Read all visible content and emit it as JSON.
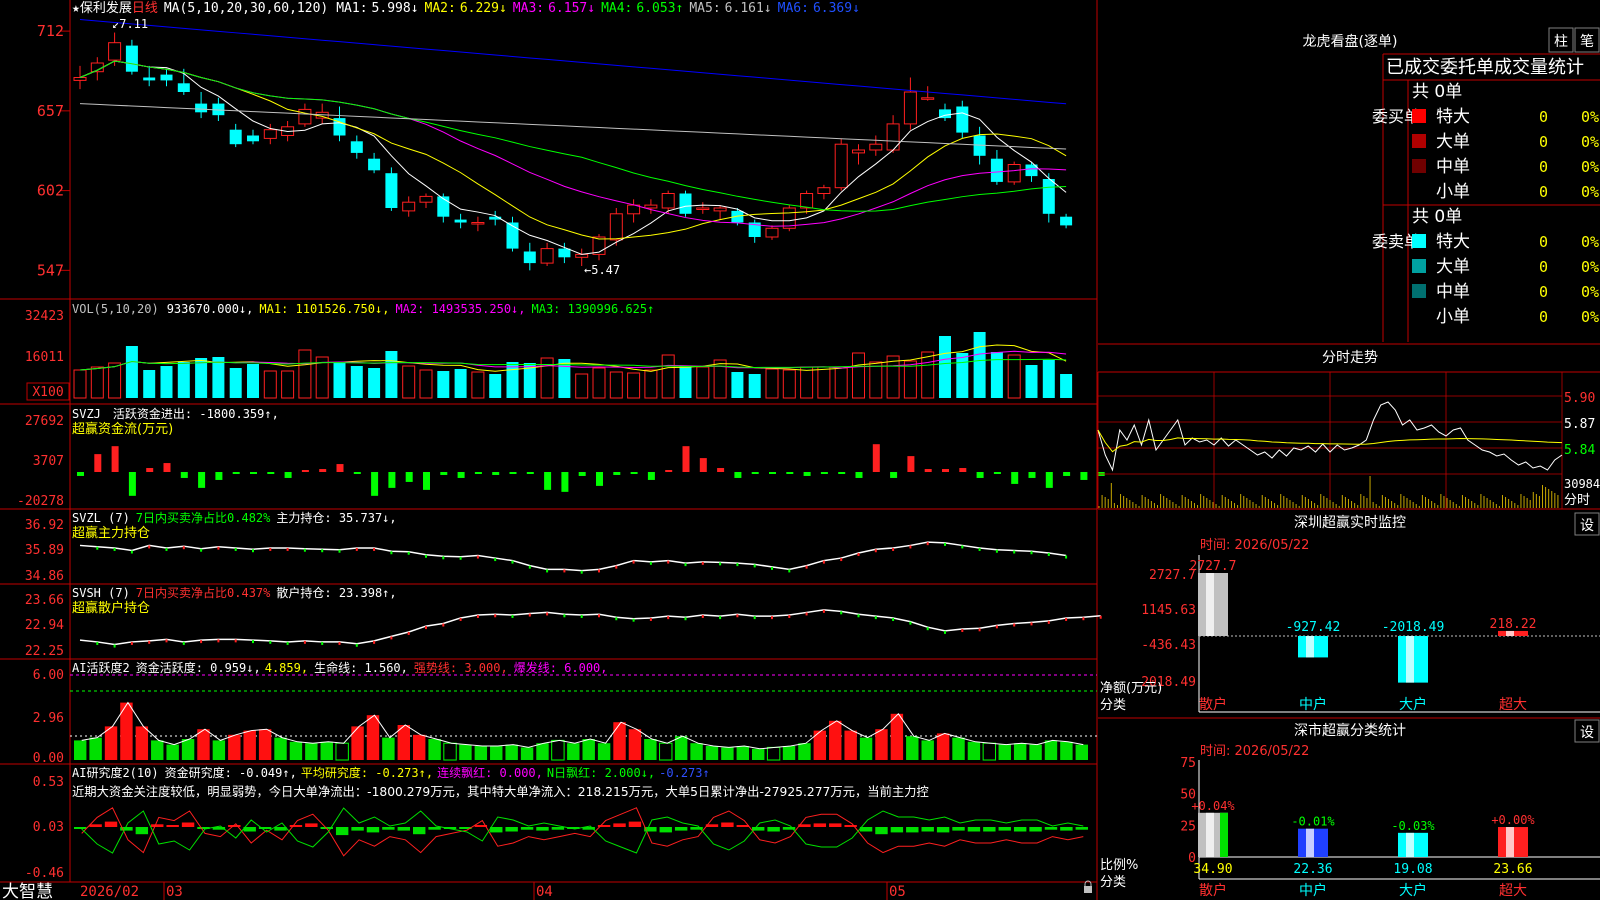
{
  "colors": {
    "up": "#ff2020",
    "down": "#00ffff",
    "bg": "#000000",
    "frame": "#c00000",
    "ma1": "#ffffff",
    "ma2": "#ffff00",
    "ma3": "#ff00ff",
    "ma4": "#00ff00",
    "ma5": "#c0c0c0",
    "ma6": "#0000ff",
    "green": "#00ff00",
    "yellow": "#ffff00",
    "magenta": "#ff00ff",
    "cyan": "#00ffff"
  },
  "app": {
    "name": "大智慧"
  },
  "k_panel": {
    "star": "★",
    "stock": "保利发展",
    "period": "日线",
    "ma_label": "MA(5,10,20,30,60,120)",
    "ma": [
      {
        "name": "MA1:",
        "value": "5.998↓"
      },
      {
        "name": "MA2:",
        "value": "6.229↓"
      },
      {
        "name": "MA3:",
        "value": "6.157↓"
      },
      {
        "name": "MA4:",
        "value": "6.053↑"
      },
      {
        "name": "MA5:",
        "value": "6.161↓"
      },
      {
        "name": "MA6:",
        "value": "6.369↓"
      }
    ],
    "axis": [
      "712",
      "657",
      "602",
      "547"
    ],
    "high_mark": "7.11",
    "low_mark": "5.47"
  },
  "vol_panel": {
    "label": "VOL(5,10,20)",
    "value": "933670.000↓,",
    "ma1": "MA1: 1101526.750↓,",
    "ma2": "MA2: 1493535.250↓,",
    "ma3": "MA3: 1390996.625↑",
    "axis": [
      "32423",
      "16011"
    ],
    "unit": "X100"
  },
  "svzj_panel": {
    "label": "SVZJ",
    "text": "活跃资金进出: -1800.359↑,",
    "title": "超赢资金流(万元)",
    "axis": [
      "27692",
      "3707",
      "-20278"
    ]
  },
  "svzl_panel": {
    "label": "SVZL (7)",
    "pct": "7日内买卖净占比0.482%",
    "main": "主力持仓: 35.737↓,",
    "title": "超赢主力持仓",
    "axis": [
      "36.92",
      "35.89",
      "34.86"
    ]
  },
  "svsh_panel": {
    "label": "SVSH (7)",
    "pct": "7日内买卖净占比0.437%",
    "retail": "散户持仓: 23.398↑,",
    "title": "超赢散户持仓",
    "axis": [
      "23.66",
      "22.94",
      "22.25"
    ]
  },
  "ai1_panel": {
    "label": "AI活跃度2",
    "t1": "资金活跃度: 0.959↓,",
    "t2": "4.859,",
    "t3": "生命线: 1.560,",
    "t4": "强势线: 3.000,",
    "t5": "爆发线: 6.000,",
    "axis": [
      "6.00",
      "2.96",
      "0.00"
    ]
  },
  "ai2_panel": {
    "label": "AI研究度2(10)",
    "t1": "资金研究度: -0.049↑,",
    "t2": "平均研究度: -0.273↑,",
    "t3": "连续飘红: 0.000,",
    "t4": "N日飘红: 2.000↓,",
    "t5": "-0.273↑",
    "comment": "近期大资金关注度较低，明显弱势，今日大单净流出：-1800.279万元，其中特大单净流入：218.215万元，大单5日累计净出-27925.277万元，当前主力控",
    "axis": [
      "0.53",
      "0.03",
      "-0.46"
    ]
  },
  "dates": {
    "d1": "2026/02",
    "d2": "03",
    "d3": "04",
    "d4": "05"
  },
  "dragon": {
    "title": "龙虎看盘(逐单)",
    "btn1": "柱",
    "btn2": "笔",
    "subtitle": "已成交委托单成交量统计",
    "buy": {
      "side": "委买单",
      "total": "共 0单",
      "rows": [
        {
          "name": "特大",
          "n": "0",
          "p": "0%",
          "c": "#ff0000"
        },
        {
          "name": "大单",
          "n": "0",
          "p": "0%",
          "c": "#b00000"
        },
        {
          "name": "中单",
          "n": "0",
          "p": "0%",
          "c": "#700000"
        },
        {
          "name": "小单",
          "n": "0",
          "p": "0%",
          "c": "#000000"
        }
      ]
    },
    "sell": {
      "side": "委卖单",
      "total": "共 0单",
      "rows": [
        {
          "name": "特大",
          "n": "0",
          "p": "0%",
          "c": "#00ffff"
        },
        {
          "name": "大单",
          "n": "0",
          "p": "0%",
          "c": "#00a0a0"
        },
        {
          "name": "中单",
          "n": "0",
          "p": "0%",
          "c": "#007070"
        },
        {
          "name": "小单",
          "n": "0",
          "p": "0%",
          "c": "#000000"
        }
      ]
    }
  },
  "fenshi": {
    "title": "分时走势",
    "axis": [
      "5.90",
      "5.87",
      "5.84"
    ],
    "vol": "30984",
    "vol_unit": "分时"
  },
  "monitor": {
    "title": "深圳超赢实时监控",
    "btn": "设",
    "time": "时间: 2026/05/22",
    "axis": [
      "2727.7",
      "1145.63",
      "-436.43",
      "-2018.49"
    ],
    "label1": "净额(万元)",
    "label2": "分类",
    "cats": [
      "散户",
      "中户",
      "大户",
      "超大"
    ],
    "vals": [
      "2727.7",
      "-927.42",
      "-2018.49",
      "218.22"
    ]
  },
  "classify": {
    "title": "深市超赢分类统计",
    "btn": "设",
    "time": "时间: 2026/05/22",
    "axis": [
      "75",
      "50",
      "25",
      "0"
    ],
    "label1": "比例%",
    "label2": "分类",
    "cats": [
      "散户",
      "中户",
      "大户",
      "超大"
    ],
    "vals": [
      "34.90",
      "22.36",
      "19.08",
      "23.66"
    ],
    "chg": [
      "+0.04%",
      "-0.01%",
      "-0.03%",
      "+0.00%"
    ]
  },
  "chart_data": [
    {
      "type": "candlestick",
      "title": "保利发展 日线",
      "ylim": [
        5.3,
        7.3
      ],
      "ohlc": [
        [
          6.78,
          6.88,
          6.72,
          6.8
        ],
        [
          6.84,
          6.94,
          6.78,
          6.9
        ],
        [
          6.92,
          7.11,
          6.88,
          7.04
        ],
        [
          7.02,
          7.06,
          6.82,
          6.84
        ],
        [
          6.8,
          6.88,
          6.74,
          6.78
        ],
        [
          6.82,
          6.86,
          6.74,
          6.78
        ],
        [
          6.76,
          6.86,
          6.68,
          6.7
        ],
        [
          6.62,
          6.7,
          6.52,
          6.56
        ],
        [
          6.62,
          6.66,
          6.5,
          6.54
        ],
        [
          6.44,
          6.48,
          6.32,
          6.34
        ],
        [
          6.4,
          6.44,
          6.34,
          6.36
        ],
        [
          6.38,
          6.48,
          6.34,
          6.44
        ],
        [
          6.4,
          6.5,
          6.36,
          6.46
        ],
        [
          6.48,
          6.62,
          6.46,
          6.58
        ],
        [
          6.52,
          6.62,
          6.48,
          6.56
        ],
        [
          6.52,
          6.6,
          6.36,
          6.4
        ],
        [
          6.36,
          6.4,
          6.24,
          6.28
        ],
        [
          6.24,
          6.28,
          6.14,
          6.16
        ],
        [
          6.14,
          6.18,
          5.88,
          5.9
        ],
        [
          5.88,
          5.98,
          5.84,
          5.94
        ],
        [
          5.94,
          6.0,
          5.9,
          5.98
        ],
        [
          5.98,
          6.0,
          5.8,
          5.84
        ],
        [
          5.82,
          5.86,
          5.76,
          5.8
        ],
        [
          5.8,
          5.84,
          5.74,
          5.8
        ],
        [
          5.84,
          5.88,
          5.78,
          5.82
        ],
        [
          5.8,
          5.84,
          5.6,
          5.62
        ],
        [
          5.6,
          5.66,
          5.47,
          5.52
        ],
        [
          5.52,
          5.66,
          5.5,
          5.62
        ],
        [
          5.62,
          5.66,
          5.52,
          5.56
        ],
        [
          5.56,
          5.62,
          5.5,
          5.58
        ],
        [
          5.58,
          5.72,
          5.54,
          5.7
        ],
        [
          5.68,
          5.9,
          5.64,
          5.86
        ],
        [
          5.86,
          5.96,
          5.8,
          5.92
        ],
        [
          5.9,
          5.96,
          5.86,
          5.92
        ],
        [
          5.9,
          6.02,
          5.86,
          6.0
        ],
        [
          6.0,
          6.02,
          5.84,
          5.86
        ],
        [
          5.9,
          5.94,
          5.86,
          5.9
        ],
        [
          5.88,
          5.92,
          5.82,
          5.9
        ],
        [
          5.88,
          5.9,
          5.78,
          5.8
        ],
        [
          5.8,
          5.82,
          5.66,
          5.7
        ],
        [
          5.7,
          5.78,
          5.68,
          5.76
        ],
        [
          5.76,
          5.92,
          5.74,
          5.9
        ],
        [
          5.9,
          6.02,
          5.86,
          6.0
        ],
        [
          6.0,
          6.06,
          5.96,
          6.04
        ],
        [
          6.04,
          6.38,
          6.02,
          6.34
        ],
        [
          6.28,
          6.34,
          6.2,
          6.3
        ],
        [
          6.3,
          6.4,
          6.26,
          6.34
        ],
        [
          6.3,
          6.54,
          6.28,
          6.48
        ],
        [
          6.48,
          6.8,
          6.44,
          6.7
        ],
        [
          6.66,
          6.74,
          6.64,
          6.66
        ],
        [
          6.58,
          6.62,
          6.5,
          6.52
        ],
        [
          6.6,
          6.64,
          6.38,
          6.42
        ],
        [
          6.4,
          6.46,
          6.2,
          6.26
        ],
        [
          6.24,
          6.3,
          6.06,
          6.08
        ],
        [
          6.08,
          6.22,
          6.06,
          6.2
        ],
        [
          6.2,
          6.22,
          6.08,
          6.12
        ],
        [
          6.1,
          6.14,
          5.8,
          5.86
        ],
        [
          5.84,
          5.86,
          5.76,
          5.78
        ]
      ]
    },
    {
      "type": "bar",
      "title": "VOL(5,10,20)",
      "ylim": [
        0,
        40000
      ],
      "values": [
        14000,
        15500,
        17500,
        26000,
        14000,
        16000,
        18000,
        20000,
        20500,
        15000,
        17000,
        13500,
        13500,
        24000,
        20500,
        18000,
        16000,
        15000,
        23500,
        16000,
        14000,
        13500,
        14500,
        13000,
        12000,
        18000,
        17500,
        20000,
        19500,
        12000,
        15000,
        13000,
        12500,
        14000,
        21500,
        16000,
        15500,
        19000,
        13000,
        12000,
        14500,
        14000,
        15500,
        15500,
        15000,
        22500,
        18000,
        21000,
        18500,
        23000,
        31000,
        22500,
        33000,
        23000,
        21500,
        16500,
        19000,
        12000
      ]
    },
    {
      "type": "bar",
      "title": "超赢资金流(万元)",
      "ylim": [
        -20278,
        27692
      ],
      "values": [
        -2000,
        9000,
        13000,
        -12000,
        2000,
        4500,
        -3000,
        -8000,
        -4000,
        -500,
        -500,
        -500,
        -3000,
        1000,
        1500,
        4000,
        -500,
        -12000,
        -8000,
        -5000,
        -9000,
        -1500,
        -3000,
        -1000,
        -1500,
        -500,
        -500,
        -9000,
        -10000,
        -2000,
        -7000,
        -1500,
        -500,
        -4000,
        500,
        13000,
        7000,
        2000,
        -3000,
        -500,
        -1000,
        -500,
        -2000,
        -500,
        -500,
        -3000,
        14000,
        -3000,
        8000,
        1500,
        1500,
        2000,
        -3000,
        -1000,
        -6000,
        -3000,
        -8000,
        -2000,
        -4000,
        -2000
      ]
    },
    {
      "type": "line",
      "title": "超赢主力持仓",
      "ylim": [
        34.86,
        36.92
      ],
      "values": [
        36.15,
        36.1,
        36.05,
        35.95,
        36.15,
        36.05,
        36.12,
        36.02,
        36.1,
        36.05,
        36.0,
        36.05,
        36.05,
        36.02,
        36.0,
        35.98,
        36.05,
        36.05,
        35.92,
        35.9,
        35.78,
        35.72,
        35.7,
        35.75,
        35.65,
        35.55,
        35.35,
        35.2,
        35.2,
        35.15,
        35.2,
        35.35,
        35.55,
        35.5,
        35.55,
        35.45,
        35.5,
        35.48,
        35.45,
        35.4,
        35.3,
        35.2,
        35.35,
        35.55,
        35.65,
        35.85,
        36.0,
        36.05,
        36.15,
        36.28,
        36.25,
        36.15,
        36.05,
        35.98,
        35.95,
        35.92,
        35.85,
        35.75
      ]
    },
    {
      "type": "line",
      "title": "超赢散户持仓",
      "ylim": [
        22.25,
        23.66
      ],
      "values": [
        22.6,
        22.55,
        22.48,
        22.55,
        22.58,
        22.62,
        22.55,
        22.6,
        22.62,
        22.62,
        22.6,
        22.58,
        22.55,
        22.58,
        22.55,
        22.55,
        22.5,
        22.58,
        22.7,
        22.82,
        22.98,
        23.05,
        23.2,
        23.28,
        23.3,
        23.28,
        23.32,
        23.35,
        23.3,
        23.28,
        23.3,
        23.22,
        23.18,
        23.2,
        23.25,
        23.22,
        23.28,
        23.25,
        23.3,
        23.25,
        23.25,
        23.28,
        23.35,
        23.42,
        23.38,
        23.3,
        23.25,
        23.2,
        23.1,
        22.95,
        22.85,
        22.9,
        22.92,
        23.0,
        23.05,
        23.08,
        23.12,
        23.2,
        23.22,
        23.26
      ]
    },
    {
      "type": "bar",
      "title": "AI活跃度2",
      "ylim": [
        0,
        6.0
      ],
      "values": [
        1.4,
        1.6,
        2.4,
        4.1,
        2.4,
        1.4,
        1.1,
        1.5,
        2.2,
        1.4,
        1.8,
        2.1,
        2.2,
        1.6,
        1.3,
        1.2,
        1.3,
        1.2,
        2.4,
        3.2,
        1.6,
        2.5,
        1.8,
        1.5,
        1.2,
        1.1,
        1.0,
        1.0,
        1.1,
        0.9,
        1.2,
        1.4,
        1.2,
        1.5,
        1.2,
        2.7,
        2.2,
        1.5,
        1.2,
        1.7,
        1.2,
        1.0,
        0.9,
        1.0,
        0.8,
        0.9,
        1.0,
        1.2,
        2.1,
        2.8,
        2.1,
        1.6,
        2.2,
        3.3,
        1.7,
        1.4,
        1.9,
        1.6,
        1.3,
        1.2,
        1.1,
        1.2,
        1.1,
        1.4,
        1.3,
        1.1
      ]
    },
    {
      "type": "bar",
      "title": "AI研究度2(10)",
      "ylim": [
        -0.46,
        0.53
      ],
      "values": [
        -0.02,
        0.03,
        0.06,
        -0.04,
        -0.08,
        0.03,
        0.02,
        0.05,
        -0.02,
        -0.03,
        0.01,
        -0.05,
        -0.01,
        -0.04,
        0.02,
        0.04,
        -0.01,
        -0.09,
        -0.04,
        -0.06,
        -0.03,
        -0.04,
        -0.08,
        -0.03,
        -0.02,
        -0.01,
        0.02,
        -0.06,
        -0.05,
        -0.03,
        -0.04,
        -0.03,
        -0.02,
        -0.03,
        0.02,
        0.04,
        0.06,
        -0.05,
        -0.06,
        -0.04,
        -0.03,
        0.03,
        0.05,
        0.02,
        -0.04,
        -0.05,
        -0.03,
        0.03,
        0.04,
        0.04,
        0.01,
        -0.05,
        -0.08,
        -0.06,
        -0.06,
        -0.05,
        -0.06,
        -0.04,
        -0.05,
        -0.05,
        -0.04,
        -0.05,
        -0.05,
        -0.03,
        -0.04,
        -0.03
      ]
    },
    {
      "type": "bar",
      "title": "深圳超赢实时监控",
      "categories": [
        "散户",
        "中户",
        "大户",
        "超大"
      ],
      "values": [
        2727.7,
        -927.42,
        -2018.49,
        218.22
      ],
      "ylim": [
        -2018.49,
        2727.7
      ]
    },
    {
      "type": "bar",
      "title": "深市超赢分类统计",
      "categories": [
        "散户",
        "中户",
        "大户",
        "超大"
      ],
      "values": [
        34.9,
        22.36,
        19.08,
        23.66
      ],
      "ylim": [
        0,
        75
      ]
    }
  ]
}
